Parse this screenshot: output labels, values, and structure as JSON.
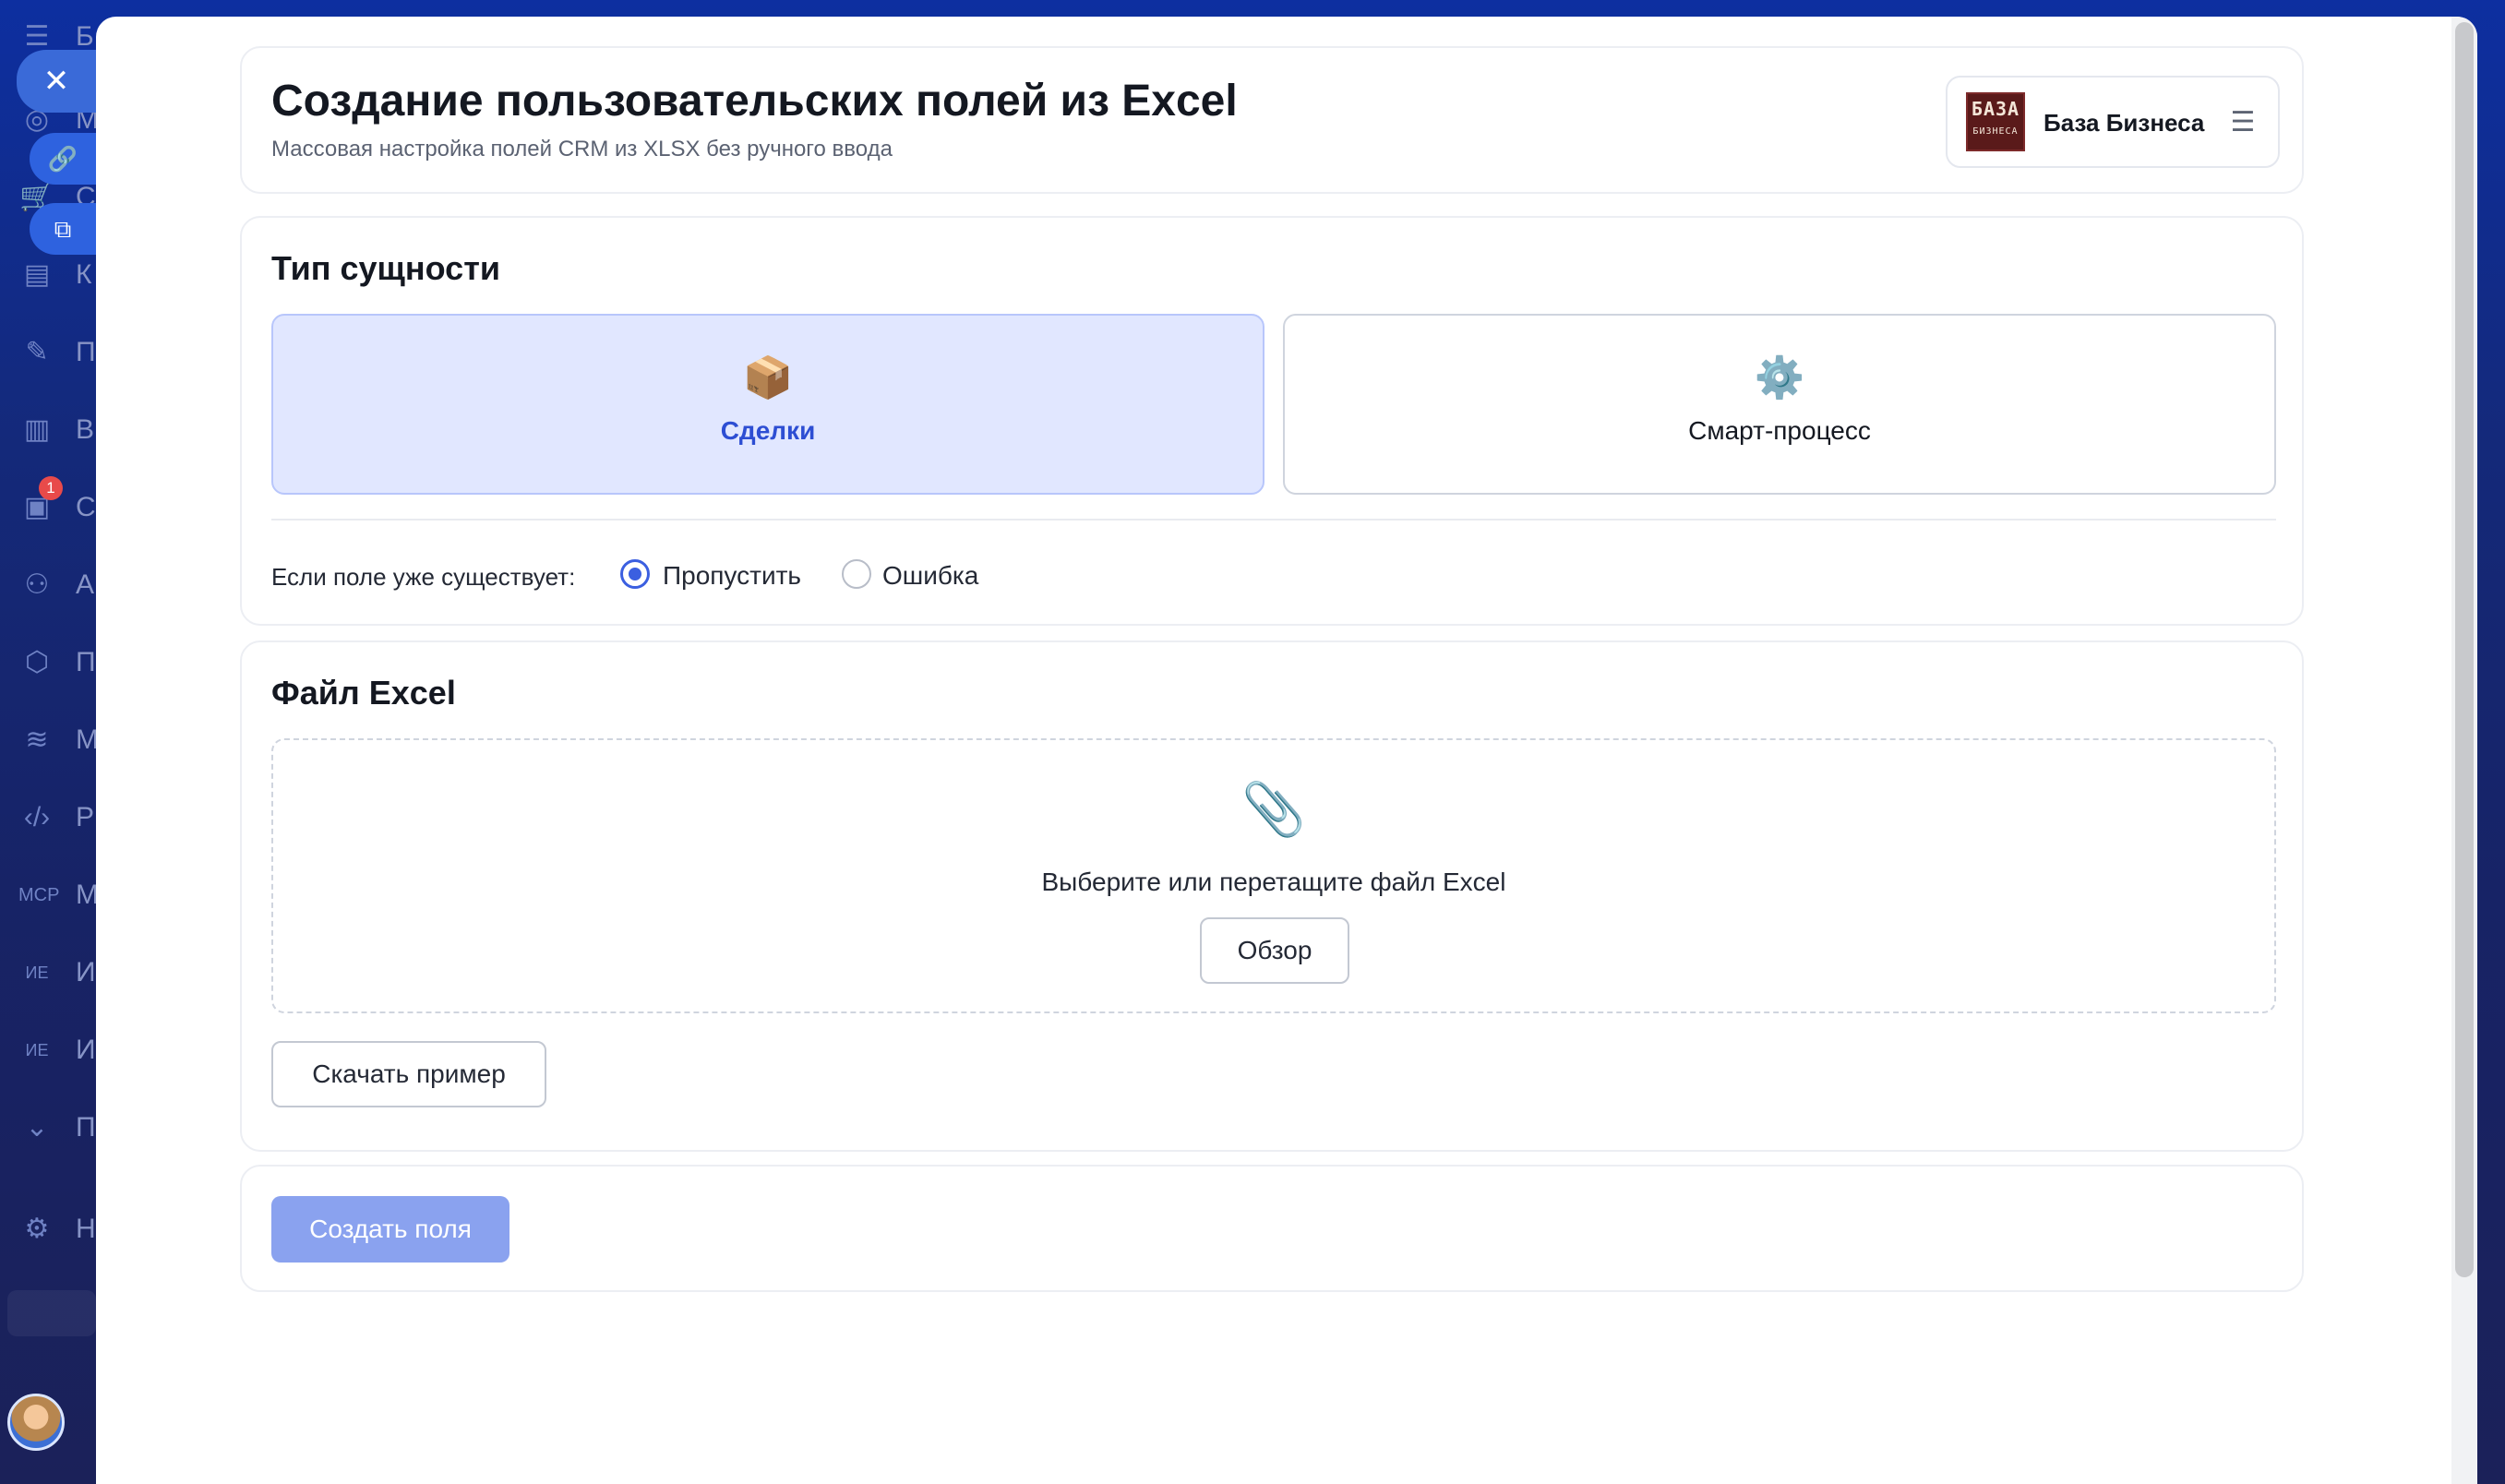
{
  "header": {
    "title": "Создание пользовательских полей из Excel",
    "subtitle": "Массовая настройка полей CRM из XLSX без ручного ввода"
  },
  "brand": {
    "logo_line1": "БАЗА",
    "logo_line2": "БИЗНЕСА",
    "name": "База Бизнеса",
    "menu_icon": "☰"
  },
  "entity_type": {
    "title": "Тип сущности",
    "options": [
      {
        "label": "Сделки",
        "icon": "📦",
        "selected": true
      },
      {
        "label": "Смарт-процесс",
        "icon": "⚙️",
        "selected": false
      }
    ],
    "exists_label": "Если поле уже существует:",
    "exists_options": [
      {
        "label": "Пропустить",
        "checked": true
      },
      {
        "label": "Ошибка",
        "checked": false
      }
    ]
  },
  "file": {
    "title": "Файл Excel",
    "drop_icon": "📎",
    "drop_text": "Выберите или перетащите файл Excel",
    "browse_label": "Обзор",
    "sample_label": "Скачать пример"
  },
  "actions": {
    "create_label": "Создать поля"
  },
  "background": {
    "close_icon": "✕",
    "link_icon": "🔗",
    "open_icon": "⧉",
    "notification_count": "1",
    "nav_letters": [
      "Б",
      "М",
      "С",
      "К",
      "П",
      "В",
      "С",
      "А",
      "П",
      "М",
      "Р",
      "М",
      "И",
      "И",
      "П",
      "Н"
    ]
  },
  "colors": {
    "accent": "#3b5fe0",
    "selected_bg": "#e1e7ff",
    "create_button": "#8aa2ef",
    "sidebar": "#14297a"
  }
}
